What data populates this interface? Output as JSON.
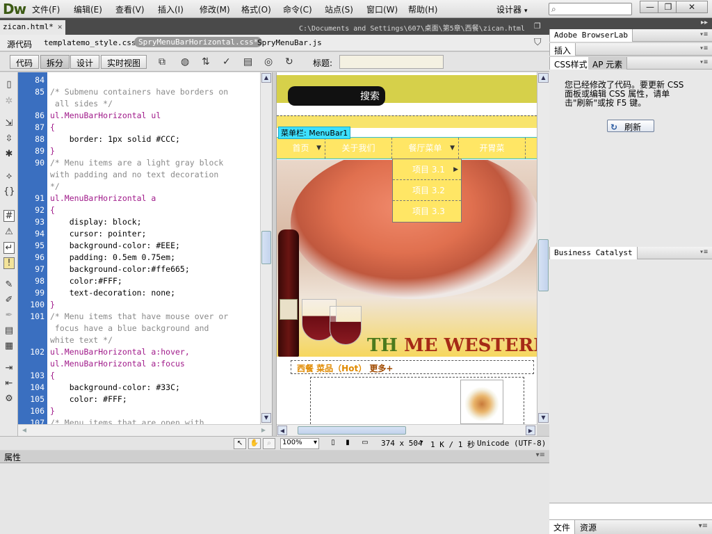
{
  "app": {
    "logo": "Dw",
    "designer": "设计器",
    "search_icon": "search-icon"
  },
  "menu": [
    "文件(F)",
    "编辑(E)",
    "查看(V)",
    "插入(I)",
    "修改(M)",
    "格式(O)",
    "命令(C)",
    "站点(S)",
    "窗口(W)",
    "帮助(H)"
  ],
  "window_buttons": [
    "—",
    "❐",
    "✕"
  ],
  "document": {
    "tab": "zican.html*",
    "path": "C:\\Documents and Settings\\607\\桌面\\第5章\\西餐\\zican.html"
  },
  "related_files": {
    "source": "源代码",
    "files": [
      "templatemo_style.css",
      "SpryMenuBarHorizontal.css*",
      "SpryMenuBar.js"
    ]
  },
  "toolbar": {
    "views": [
      "代码",
      "拆分",
      "设计",
      "实时视图"
    ],
    "title_label": "标题:",
    "title_value": ""
  },
  "code": {
    "lines": [
      {
        "n": "84",
        "text": "",
        "cls": "c-prop"
      },
      {
        "n": "85",
        "text": "/* Submenu containers have borders on",
        "cls": "c-comment"
      },
      {
        "n": "",
        "text": " all sides */",
        "cls": "c-comment"
      },
      {
        "n": "86",
        "text": "ul.MenuBarHorizontal ul",
        "cls": "c-sel"
      },
      {
        "n": "87",
        "text": "{",
        "cls": "c-brace"
      },
      {
        "n": "88",
        "text": "    border: 1px solid #CCC;",
        "cls": "c-prop"
      },
      {
        "n": "89",
        "text": "}",
        "cls": "c-brace"
      },
      {
        "n": "90",
        "text": "/* Menu items are a light gray block",
        "cls": "c-comment"
      },
      {
        "n": "",
        "text": "with padding and no text decoration",
        "cls": "c-comment"
      },
      {
        "n": "",
        "text": "*/",
        "cls": "c-comment"
      },
      {
        "n": "91",
        "text": "ul.MenuBarHorizontal a",
        "cls": "c-sel"
      },
      {
        "n": "92",
        "text": "{",
        "cls": "c-brace"
      },
      {
        "n": "93",
        "text": "    display: block;",
        "cls": "c-prop"
      },
      {
        "n": "94",
        "text": "    cursor: pointer;",
        "cls": "c-prop"
      },
      {
        "n": "95",
        "text": "    background-color: #EEE;",
        "cls": "c-prop"
      },
      {
        "n": "96",
        "text": "    padding: 0.5em 0.75em;",
        "cls": "c-prop"
      },
      {
        "n": "97",
        "text": "    background-color:#ffe665;",
        "cls": "c-prop"
      },
      {
        "n": "98",
        "text": "    color:#FFF;",
        "cls": "c-prop"
      },
      {
        "n": "99",
        "text": "    text-decoration: none;",
        "cls": "c-prop"
      },
      {
        "n": "100",
        "text": "}",
        "cls": "c-brace"
      },
      {
        "n": "101",
        "text": "/* Menu items that have mouse over or",
        "cls": "c-comment"
      },
      {
        "n": "",
        "text": " focus have a blue background and",
        "cls": "c-comment"
      },
      {
        "n": "",
        "text": "white text */",
        "cls": "c-comment"
      },
      {
        "n": "102",
        "text": "ul.MenuBarHorizontal a:hover,",
        "cls": "c-sel"
      },
      {
        "n": "",
        "text": "ul.MenuBarHorizontal a:focus",
        "cls": "c-sel"
      },
      {
        "n": "103",
        "text": "{",
        "cls": "c-brace"
      },
      {
        "n": "104",
        "text": "    background-color: #33C;",
        "cls": "c-prop"
      },
      {
        "n": "105",
        "text": "    color: #FFF;",
        "cls": "c-prop"
      },
      {
        "n": "106",
        "text": "}",
        "cls": "c-brace"
      },
      {
        "n": "107",
        "text": "/* Menu items that are open with",
        "cls": "c-comment"
      }
    ]
  },
  "design": {
    "search_button": "搜索",
    "menubar_tag": "菜单栏: MenuBar1",
    "menu_items": [
      "首页",
      "关于我们",
      "餐厅菜单",
      "开胃菜"
    ],
    "submenu_items": [
      "项目 3.1",
      "项目 3.2",
      "项目 3.3"
    ],
    "hero_title_1": "TH",
    "hero_title_2": "ME WESTERN",
    "hot_label": "西餐 菜品（Hot）",
    "hot_more": "更多+"
  },
  "status": {
    "zoom": "100%",
    "size": "374 x 504",
    "download": "1 K / 1 秒",
    "encoding": "Unicode (UTF-8)"
  },
  "properties": {
    "title": "属性"
  },
  "right_panels": {
    "browserlab": "Adobe BrowserLab",
    "insert": "插入",
    "css_tab": "CSS样式",
    "ap_tab": "AP 元素",
    "css_message": "您已经修改了代码。要更新 CSS 面板或编辑 CSS 属性，请单击\"刷新\"或按 F5 键。",
    "refresh": "刷新",
    "business_catalyst": "Business Catalyst",
    "files_tab": "文件",
    "assets_tab": "资源"
  }
}
